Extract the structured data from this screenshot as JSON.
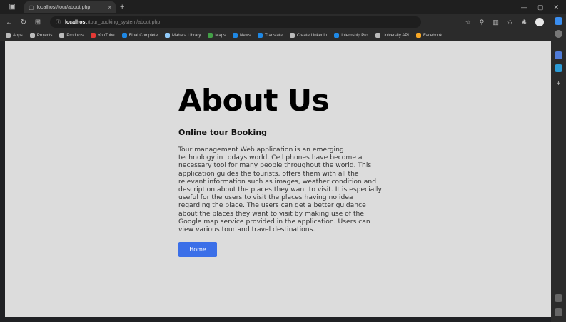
{
  "browser": {
    "tab_title": "localhost/tour/about.php",
    "tab_close": "×",
    "new_tab": "+",
    "url_host": "localhost",
    "url_path": "/tour_booking_system/about.php",
    "bookmarks": [
      {
        "label": "Apps",
        "color": "#bbbbbb"
      },
      {
        "label": "Projects",
        "color": "#bbbbbb"
      },
      {
        "label": "Products",
        "color": "#bbbbbb"
      },
      {
        "label": "YouTube",
        "color": "#e53935"
      },
      {
        "label": "Final Complete",
        "color": "#1e88e5"
      },
      {
        "label": "Mahara Library",
        "color": "#90caf9"
      },
      {
        "label": "Maps",
        "color": "#43a047"
      },
      {
        "label": "News",
        "color": "#1e88e5"
      },
      {
        "label": "Translate",
        "color": "#1e88e5"
      },
      {
        "label": "Create LinkedIn",
        "color": "#bbbbbb"
      },
      {
        "label": "Internship Pro",
        "color": "#1e88e5"
      },
      {
        "label": "University API",
        "color": "#bbbbbb"
      },
      {
        "label": "Facebook",
        "color": "#f9a825"
      }
    ]
  },
  "page": {
    "heading": "About Us",
    "subheading": "Online tour Booking",
    "paragraph": "Tour management Web application is an emerging technology in todays world. Cell phones have become a necessary tool for many people throughout the world. This application guides the tourists, offers them with all the relevant information such as images, weather condition and description about the places they want to visit. It is especially useful for the users to visit the places having no idea regarding the place. The users can get a better guidance about the places they want to visit by making use of the Google map service provided in the application. Users can view various tour and travel destinations.",
    "home_button": "Home"
  },
  "colors": {
    "button": "#3b6fe8",
    "page_bg": "#dcdcdc"
  }
}
